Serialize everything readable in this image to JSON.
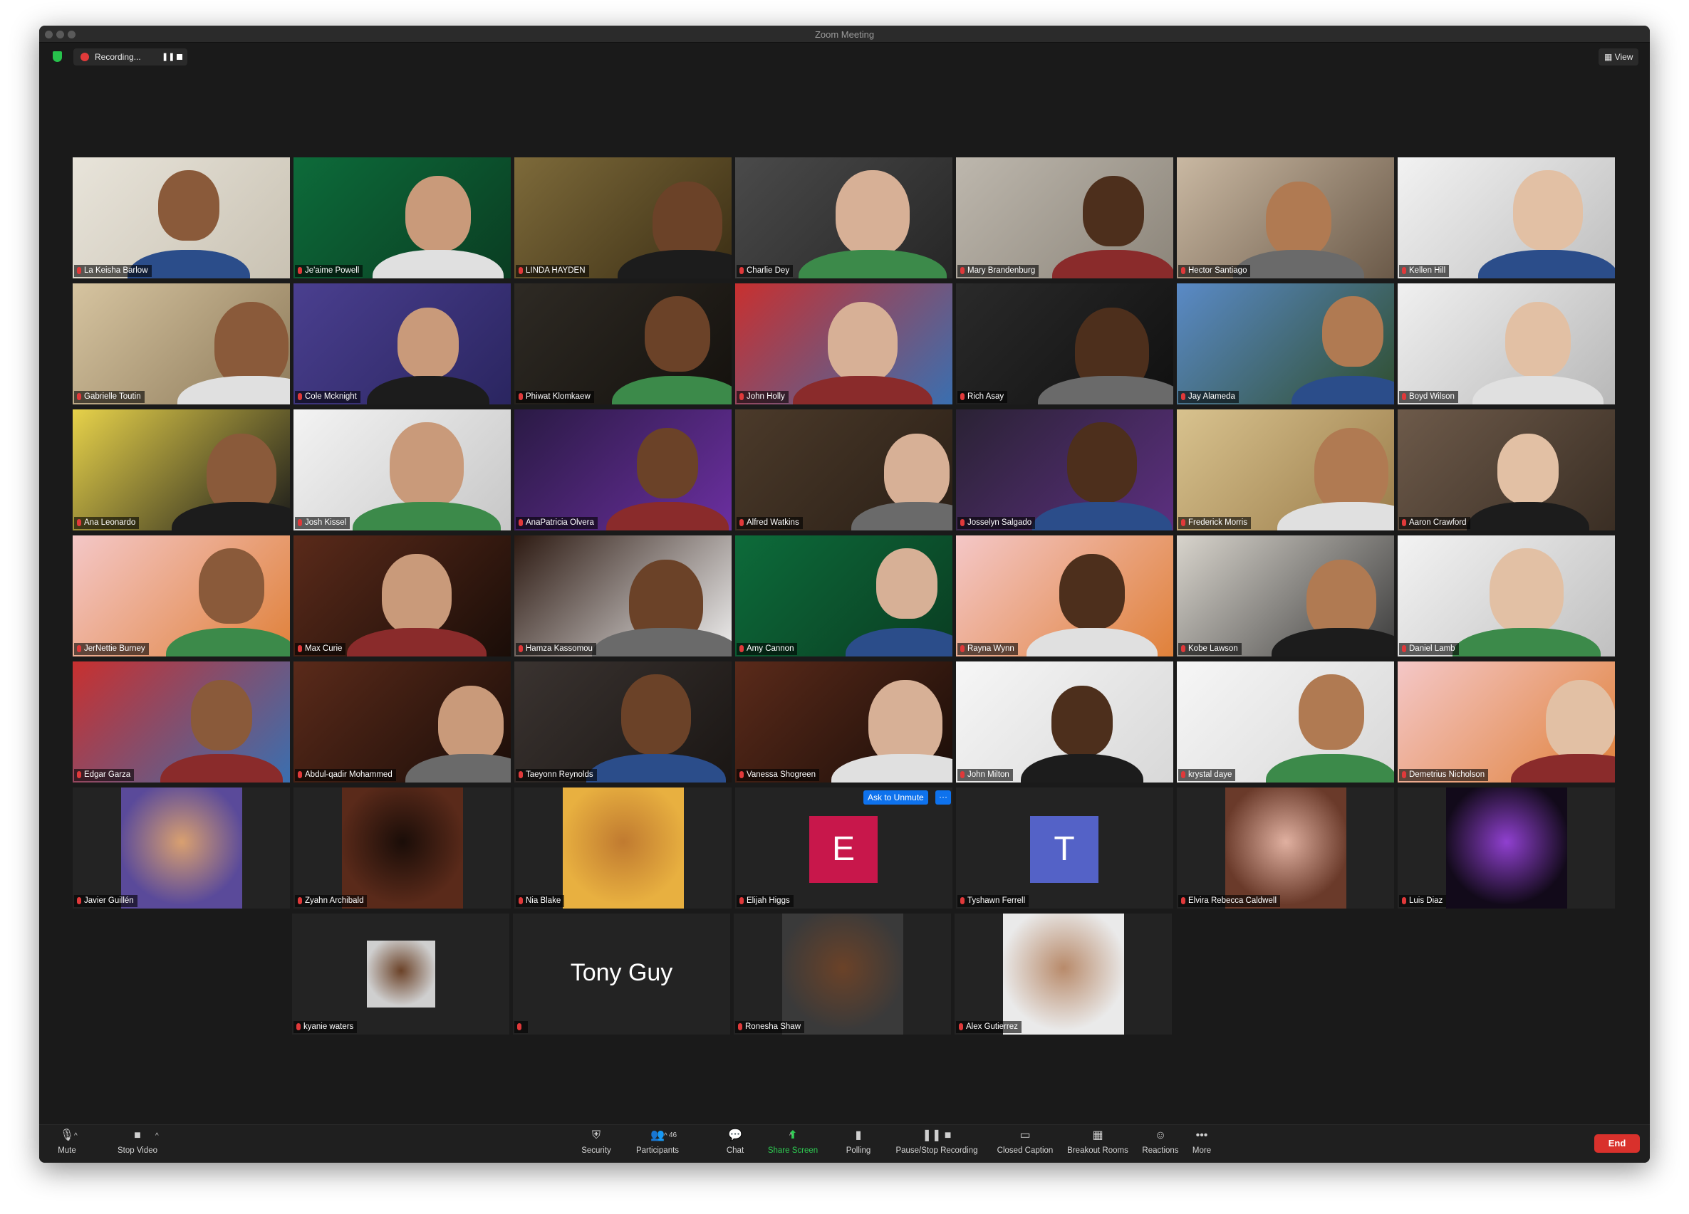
{
  "window": {
    "title": "Zoom Meeting"
  },
  "topbar": {
    "recording_label": "Recording...",
    "pause_icon": "pause-icon",
    "view_label": "View"
  },
  "participants": [
    "La Keisha Barlow",
    "Je'aime Powell",
    "LINDA HAYDEN",
    "Charlie Dey",
    "Mary Brandenburg",
    "Hector Santiago",
    "Kellen Hill",
    "Gabrielle Toutin",
    "Cole Mcknight",
    "Phiwat Klomkaew",
    "John Holly",
    "Rich Asay",
    "Jay Alameda",
    "Boyd Wilson",
    "Ana Leonardo",
    "Josh Kissel",
    "AnaPatricia Olvera",
    "Alfred Watkins",
    "Josselyn Salgado",
    "Frederick Morris",
    "Aaron Crawford",
    "JerNettie Burney",
    "Max Curie",
    "Hamza Kassomou",
    "Amy Cannon",
    "Rayna Wynn",
    "Kobe Lawson",
    "Daniel Lamb",
    "Edgar Garza",
    "Abdul-qadir Mohammed",
    "Taeyonn Reynolds",
    "Vanessa Shogreen",
    "John Milton",
    "krystal daye",
    "Demetrius Nicholson",
    "Javier Guillén",
    "Zyahn Archibald",
    "Nia Blake",
    "Elijah Higgs",
    "Tyshawn Ferrell",
    "Elvira Rebecca Caldwell",
    "Luis Diaz",
    "kyanie waters",
    "",
    "Ronesha Shaw",
    "Alex Gutierrez"
  ],
  "tile_overlays": {
    "elijah_initial": "E",
    "tyshawn_initial": "T",
    "tony_name": "Tony Guy",
    "ask_to_unmute": "Ask to Unmute",
    "more_dots": "···"
  },
  "colors": {
    "elijah_avatar": "#c8174b",
    "tyshawn_avatar": "#5462c7",
    "end": "#d9312c",
    "share_green": "#2ecc52",
    "active_speaker": "#e9e24a"
  },
  "toolbar": {
    "mute": "Mute",
    "stop_video": "Stop Video",
    "security": "Security",
    "participants": "Participants",
    "participants_count": "46",
    "chat": "Chat",
    "share_screen": "Share Screen",
    "polling": "Polling",
    "pause_stop_recording": "Pause/Stop Recording",
    "closed_caption": "Closed Caption",
    "breakout_rooms": "Breakout Rooms",
    "reactions": "Reactions",
    "more": "More",
    "end": "End"
  }
}
